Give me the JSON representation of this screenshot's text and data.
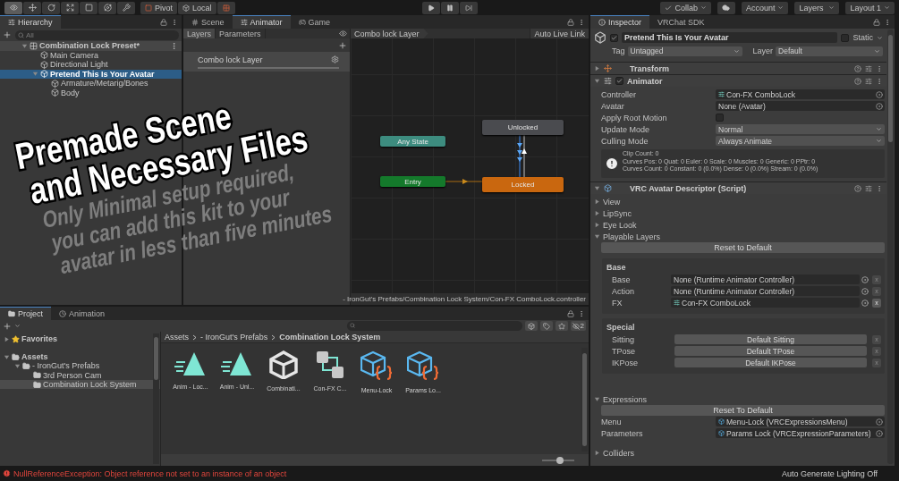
{
  "toolbar": {
    "tools": [
      {
        "selected": true
      },
      {
        "selected": false
      },
      {
        "selected": false
      },
      {
        "selected": false
      },
      {
        "selected": false
      },
      {
        "selected": false
      },
      {
        "selected": false
      }
    ],
    "pivot": "Pivot",
    "local": "Local",
    "menus": [
      {
        "label": "Collab",
        "kind": "collab"
      },
      {
        "label": "Account",
        "kind": "menu"
      },
      {
        "label": "Layers",
        "kind": "menu"
      },
      {
        "label": "Layout 1",
        "kind": "menu"
      }
    ]
  },
  "hierarchy": {
    "title": "Hierarchy",
    "search_placeholder": "All",
    "tree": [
      {
        "label": "Combination Lock Preset*",
        "kind": "scene",
        "expanded": true,
        "selected": false,
        "children": [
          {
            "label": "Main Camera",
            "kind": "object",
            "selected": false
          },
          {
            "label": "Directional Light",
            "kind": "object",
            "selected": false
          },
          {
            "label": "Pretend This Is Your Avatar",
            "kind": "object",
            "expanded": true,
            "selected": true,
            "children": [
              {
                "label": "Armature/Metarig/Bones",
                "kind": "object",
                "selected": false
              },
              {
                "label": "Body",
                "kind": "object",
                "selected": false
              }
            ]
          }
        ]
      }
    ]
  },
  "animator": {
    "tabs": [
      {
        "label": "Scene",
        "kind": "scene",
        "selected": false
      },
      {
        "label": "Animator",
        "kind": "animator",
        "selected": true
      },
      {
        "label": "Game",
        "kind": "game",
        "selected": false
      }
    ],
    "side_tabs": [
      {
        "label": "Layers",
        "selected": true
      },
      {
        "label": "Parameters",
        "selected": false
      }
    ],
    "layers": [
      {
        "name": "Combo lock Layer"
      }
    ],
    "breadcrumb": "Combo lock Layer",
    "live_link": "Auto Live Link",
    "states": [
      {
        "name": "Any State",
        "kind": "any"
      },
      {
        "name": "Entry",
        "kind": "entry"
      },
      {
        "name": "Unlocked",
        "kind": "normal"
      },
      {
        "name": "Locked",
        "kind": "default"
      }
    ],
    "path": "- IronGut's Prefabs/Combination Lock System/Con-FX ComboLock.controller"
  },
  "inspector": {
    "tabs": [
      {
        "label": "Inspector",
        "selected": true
      },
      {
        "label": "VRChat SDK",
        "selected": false
      }
    ],
    "object": {
      "name": "Pretend This Is Your Avatar",
      "active": true,
      "static_label": "Static",
      "static": false,
      "tag_label": "Tag",
      "tag": "Untagged",
      "layer_label": "Layer",
      "layer": "Default"
    },
    "transform": {
      "title": "Transform",
      "expanded": false
    },
    "animator": {
      "title": "Animator",
      "expanded": true,
      "enabled": true,
      "fields": [
        {
          "label": "Controller",
          "kind": "object",
          "value": "Con-FX ComboLock",
          "asset": true
        },
        {
          "label": "Avatar",
          "kind": "object",
          "value": "None (Avatar)",
          "asset": false
        },
        {
          "label": "Apply Root Motion",
          "kind": "toggle",
          "checked": false
        },
        {
          "label": "Update Mode",
          "kind": "dropdown",
          "value": "Normal"
        },
        {
          "label": "Culling Mode",
          "kind": "dropdown",
          "value": "Always Animate"
        }
      ],
      "info": [
        "Clip Count: 0",
        "Curves Pos: 0 Quat: 0 Euler: 0 Scale: 0 Muscles: 0 Generic: 0 PPtr: 0",
        "Curves Count: 0 Constant: 0 (0.0%) Dense: 0 (0.0%) Stream: 0 (0.0%)"
      ]
    },
    "descriptor": {
      "title": "VRC Avatar Descriptor (Script)",
      "sections": [
        {
          "label": "View",
          "expanded": false
        },
        {
          "label": "LipSync",
          "expanded": false
        },
        {
          "label": "Eye Look",
          "expanded": false
        },
        {
          "label": "Playable Layers",
          "expanded": true
        }
      ],
      "reset": "Reset to Default",
      "base": {
        "title": "Base",
        "rows": [
          {
            "label": "Base",
            "value": "None (Runtime Animator Controller)",
            "asset": false,
            "clear": "x",
            "clear_enabled": false
          },
          {
            "label": "Action",
            "value": "None (Runtime Animator Controller)",
            "asset": false,
            "clear": "x",
            "clear_enabled": false
          },
          {
            "label": "FX",
            "value": "Con-FX ComboLock",
            "asset": true,
            "clear": "x",
            "clear_enabled": true
          }
        ]
      },
      "special": {
        "title": "Special",
        "rows": [
          {
            "label": "Sitting",
            "button": "Default Sitting",
            "clear": "x"
          },
          {
            "label": "TPose",
            "button": "Default TPose",
            "clear": "x"
          },
          {
            "label": "IKPose",
            "button": "Default IKPose",
            "clear": "x"
          }
        ]
      },
      "expressions": {
        "label": "Expressions",
        "expanded": true,
        "reset": "Reset To Default",
        "rows": [
          {
            "label": "Menu",
            "value": "Menu-Lock (VRCExpressionsMenu)"
          },
          {
            "label": "Parameters",
            "value": "Params Lock (VRCExpressionParameters)"
          }
        ]
      },
      "colliders": {
        "label": "Colliders",
        "expanded": false
      }
    }
  },
  "project": {
    "tabs": [
      {
        "label": "Project",
        "kind": "project",
        "selected": true
      },
      {
        "label": "Animation",
        "kind": "animation",
        "selected": false
      }
    ],
    "hidden_count": "2",
    "favorites": {
      "label": "Favorites",
      "expanded": false
    },
    "tree": [
      {
        "label": "Assets",
        "expanded": true,
        "selected": false,
        "children": [
          {
            "label": "- IronGut's Prefabs",
            "expanded": true,
            "selected": false,
            "children": [
              {
                "label": "3rd Person Cam",
                "selected": false
              },
              {
                "label": "Combination Lock System",
                "selected": true
              }
            ]
          }
        ]
      }
    ],
    "breadcrumb": [
      "Assets",
      "- IronGut's Prefabs",
      "Combination Lock System"
    ],
    "assets": [
      {
        "name": "Anim - Loc...",
        "kind": "anim"
      },
      {
        "name": "Anim - Unl...",
        "kind": "anim"
      },
      {
        "name": "Combinati...",
        "kind": "scene"
      },
      {
        "name": "Con-FX C...",
        "kind": "controller"
      },
      {
        "name": "Menu-Lock",
        "kind": "menu"
      },
      {
        "name": "Params Lo...",
        "kind": "params"
      }
    ],
    "zoom": {
      "level": 0.55
    }
  },
  "status_bar": {
    "error": "NullReferenceException: Object reference not set to an instance of an object",
    "lighting": "Auto Generate Lighting Off"
  },
  "promo": {
    "headline": [
      "Premade Scene",
      "and Necessary Files"
    ],
    "subline": [
      "Only Minimal setup required,",
      "you can add this kit to your",
      "avatar in less than five minutes"
    ]
  }
}
